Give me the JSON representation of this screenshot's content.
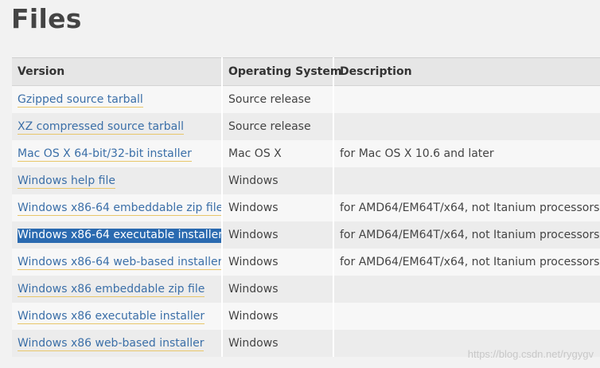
{
  "page": {
    "title": "Files"
  },
  "table": {
    "headers": {
      "version": "Version",
      "os": "Operating System",
      "description": "Description"
    },
    "rows": [
      {
        "version": "Gzipped source tarball",
        "os": "Source release",
        "description": ""
      },
      {
        "version": "XZ compressed source tarball",
        "os": "Source release",
        "description": ""
      },
      {
        "version": "Mac OS X 64-bit/32-bit installer",
        "os": "Mac OS X",
        "description": "for Mac OS X 10.6 and later"
      },
      {
        "version": "Windows help file",
        "os": "Windows",
        "description": ""
      },
      {
        "version": "Windows x86-64 embeddable zip file",
        "os": "Windows",
        "description": "for AMD64/EM64T/x64, not Itanium processors"
      },
      {
        "version": "Windows x86-64 executable installer",
        "os": "Windows",
        "description": "for AMD64/EM64T/x64, not Itanium processors"
      },
      {
        "version": "Windows x86-64 web-based installer",
        "os": "Windows",
        "description": "for AMD64/EM64T/x64, not Itanium processors"
      },
      {
        "version": "Windows x86 embeddable zip file",
        "os": "Windows",
        "description": ""
      },
      {
        "version": "Windows x86 executable installer",
        "os": "Windows",
        "description": ""
      },
      {
        "version": "Windows x86 web-based installer",
        "os": "Windows",
        "description": ""
      }
    ]
  },
  "watermark": "https://blog.csdn.net/rygygv",
  "colors": {
    "link": "#3b6fa8",
    "link_underline": "#e8c66a",
    "selection": "#2a6ab0",
    "header_bg": "#e6e6e6"
  }
}
